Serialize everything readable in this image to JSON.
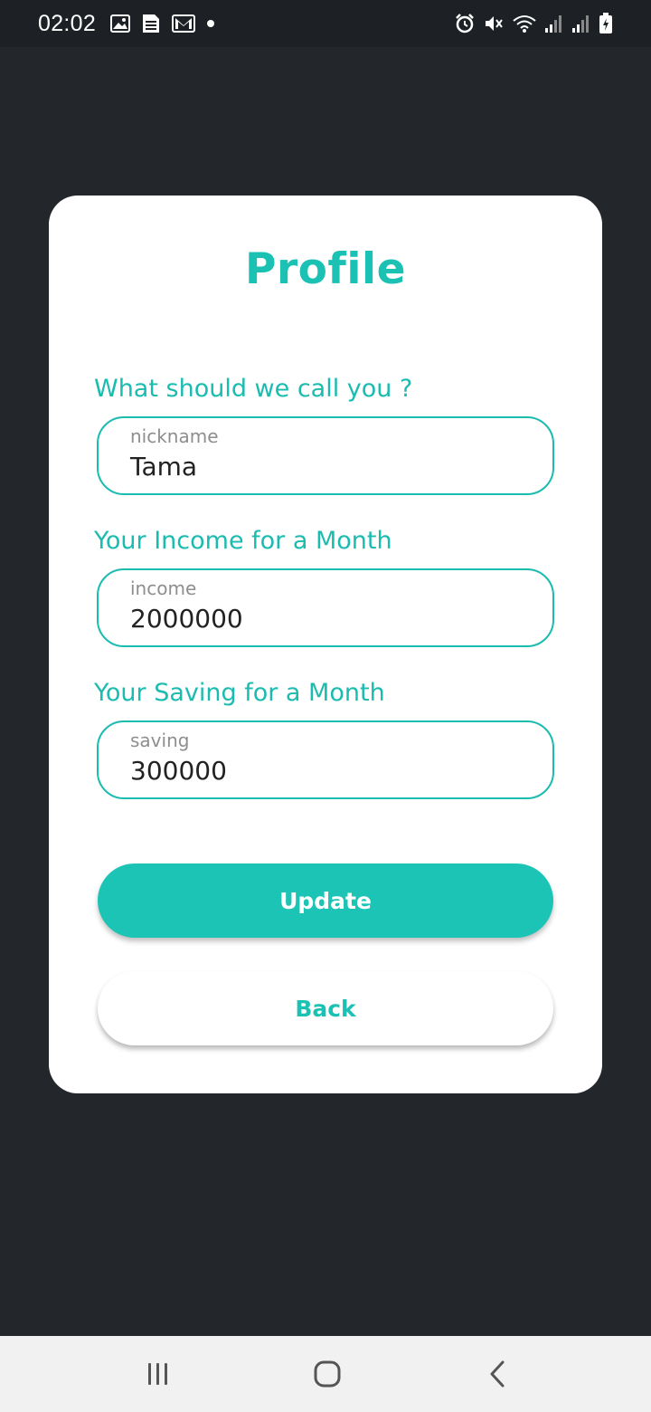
{
  "status_bar": {
    "time": "02:02",
    "left_icons": [
      "image-icon",
      "sim-card-icon",
      "gmail-icon",
      "dot-icon"
    ],
    "right_icons": [
      "alarm-icon",
      "mute-icon",
      "wifi-icon",
      "signal-icon",
      "signal-icon",
      "battery-charging-icon"
    ]
  },
  "profile": {
    "title": "Profile",
    "fields": [
      {
        "label": "What should we call you ?",
        "hint": "nickname",
        "value": "Tama"
      },
      {
        "label": "Your Income for a Month",
        "hint": "income",
        "value": "2000000"
      },
      {
        "label": "Your Saving for a Month",
        "hint": "saving",
        "value": "300000"
      }
    ],
    "update_label": "Update",
    "back_label": "Back"
  },
  "nav_bar": {
    "items": [
      "recent-apps-icon",
      "home-icon",
      "back-icon"
    ]
  },
  "colors": {
    "accent": "#1bc1b3",
    "background": "#23272c",
    "card": "#ffffff"
  }
}
